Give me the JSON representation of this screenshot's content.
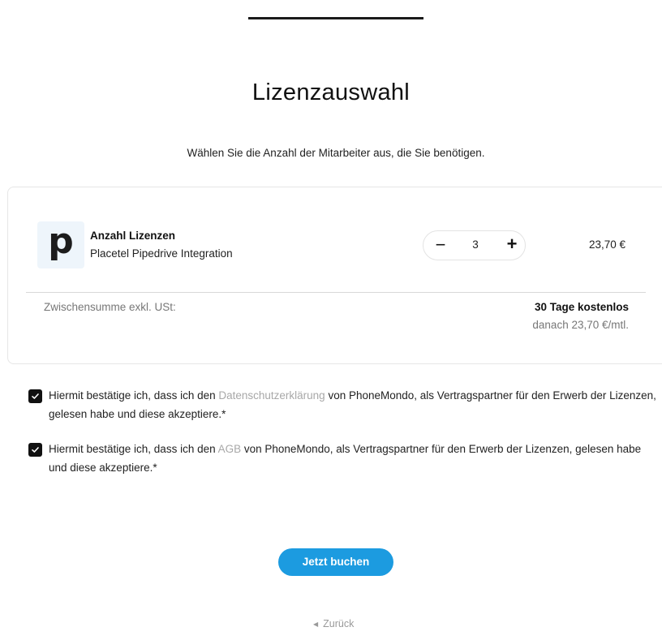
{
  "page": {
    "title": "Lizenzauswahl",
    "subtitle": "Wählen Sie die Anzahl der Mitarbeiter aus, die Sie benötigen."
  },
  "product": {
    "logo_letter": "p",
    "name": "Anzahl Lizenzen",
    "description": "Placetel Pipedrive Integration",
    "quantity": "3",
    "minus_symbol": "−",
    "plus_symbol": "+",
    "price": "23,70 €"
  },
  "summary": {
    "subtotal_label": "Zwischensumme exkl. USt:",
    "trial_text": "30 Tage kostenlos",
    "after_trial_text": "danach 23,70 €/mtl."
  },
  "consents": [
    {
      "checked": true,
      "prefix": "Hiermit bestätige ich, dass ich den ",
      "link": "Datenschutzerklärung",
      "suffix": " von PhoneMondo, als Vertragspartner für den Erwerb der Lizenzen, gelesen habe und diese akzeptiere.*"
    },
    {
      "checked": true,
      "prefix": "Hiermit bestätige ich, dass ich den ",
      "link": "AGB",
      "suffix": " von PhoneMondo, als Vertragspartner für den Erwerb der Lizenzen, gelesen habe und diese akzeptiere.*"
    }
  ],
  "actions": {
    "book_label": "Jetzt buchen",
    "back_label": "Zurück"
  },
  "colors": {
    "accent": "#1c9be0",
    "link_muted": "#a8a8a8",
    "logo_bg": "#eef5fb"
  },
  "icons": {
    "checkbox": "check-icon",
    "back": "chevron-left-icon"
  }
}
